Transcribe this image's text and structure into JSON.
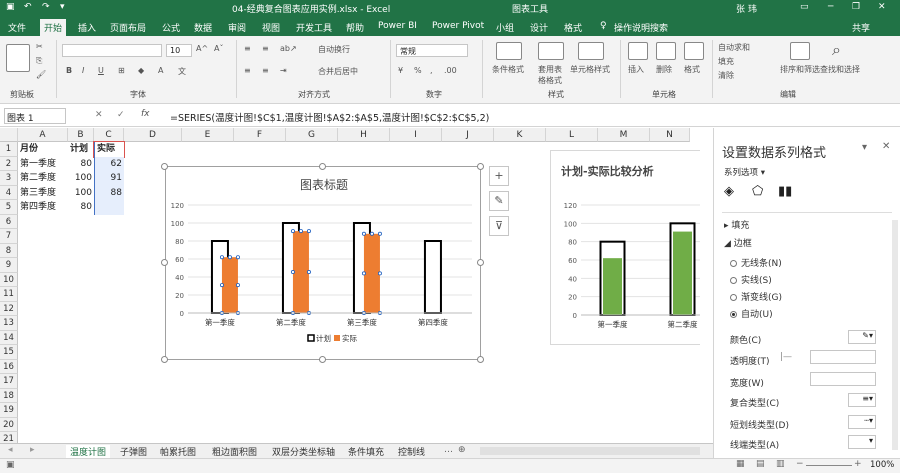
{
  "title": {
    "file": "04-经典复合图表应用实例.xlsx - Excel",
    "context": "图表工具",
    "user": "张 玮"
  },
  "tabs": [
    "文件",
    "开始",
    "插入",
    "页面布局",
    "公式",
    "数据",
    "审阅",
    "视图",
    "开发工具",
    "帮助",
    "Power BI",
    "Power Pivot",
    "小组",
    "设计",
    "格式"
  ],
  "tell_me": "操作说明搜索",
  "share": "共享",
  "ribbon": {
    "groups": [
      "剪贴板",
      "字体",
      "对齐方式",
      "数字",
      "样式",
      "单元格",
      "编辑"
    ],
    "font_size": "10",
    "number_format": "常规",
    "wrap_text": "自动换行",
    "merge_center": "合并后居中",
    "styles": [
      "条件格式",
      "套用表格格式",
      "单元格样式"
    ],
    "cells": [
      "插入",
      "删除",
      "格式"
    ],
    "editing": [
      "自动求和",
      "填充",
      "清除",
      "排序和筛选",
      "查找和选择"
    ]
  },
  "formula_bar": {
    "name_box": "图表 1",
    "fx": "fx",
    "formula": "=SERIES(温度计图!$C$1,温度计图!$A$2:$A$5,温度计图!$C$2:$C$5,2)"
  },
  "sheet": {
    "columns": [
      "A",
      "B",
      "C",
      "D",
      "E",
      "F",
      "G",
      "H",
      "I",
      "J",
      "K",
      "L",
      "M",
      "N"
    ],
    "rows": [
      "1",
      "2",
      "3",
      "4",
      "5",
      "6",
      "7",
      "8",
      "9",
      "10",
      "11",
      "12",
      "13",
      "14",
      "15",
      "16",
      "17",
      "18",
      "19",
      "20",
      "21"
    ],
    "table": [
      [
        "月份",
        "计划",
        "实际"
      ],
      [
        "第一季度",
        "80",
        "62"
      ],
      [
        "第二季度",
        "100",
        "91"
      ],
      [
        "第三季度",
        "100",
        "88"
      ],
      [
        "第四季度",
        "80",
        ""
      ]
    ]
  },
  "chart_data": [
    {
      "type": "bar",
      "title": "图表标题",
      "categories": [
        "第一季度",
        "第二季度",
        "第三季度",
        "第四季度"
      ],
      "series": [
        {
          "name": "计划",
          "values": [
            80,
            100,
            100,
            80
          ]
        },
        {
          "name": "实际",
          "values": [
            62,
            91,
            88,
            null
          ]
        }
      ],
      "ylim": [
        0,
        120
      ],
      "yticks": [
        "0",
        "20",
        "40",
        "60",
        "80",
        "100",
        "120"
      ],
      "legend": "bottom",
      "colors": {
        "plan": "#000000",
        "actual": "#ed7d31"
      }
    },
    {
      "type": "bar",
      "title": "计划-实际比较分析",
      "categories": [
        "第一季度",
        "第二季度"
      ],
      "series": [
        {
          "name": "计划",
          "values": [
            80,
            100
          ]
        },
        {
          "name": "实际",
          "values": [
            62,
            91
          ]
        }
      ],
      "ylim": [
        0,
        120
      ],
      "yticks": [
        "0",
        "20",
        "40",
        "60",
        "80",
        "100",
        "120"
      ],
      "colors": {
        "plan": "#000000",
        "actual": "#70ad47"
      }
    }
  ],
  "pane": {
    "title": "设置数据系列格式",
    "series_options": "系列选项",
    "fill": "填充",
    "border": "边框",
    "border_options": [
      "无线条(N)",
      "实线(S)",
      "渐变线(G)",
      "自动(U)"
    ],
    "props": [
      "颜色(C)",
      "透明度(T)",
      "宽度(W)",
      "复合类型(C)",
      "短划线类型(D)",
      "线端类型(A)"
    ]
  },
  "sheet_tabs": [
    "温度计图",
    "子弹图",
    "帕累托图",
    "粗边面积图",
    "双层分类坐标轴",
    "条件填充",
    "控制线"
  ],
  "status": {
    "zoom": "100%"
  }
}
